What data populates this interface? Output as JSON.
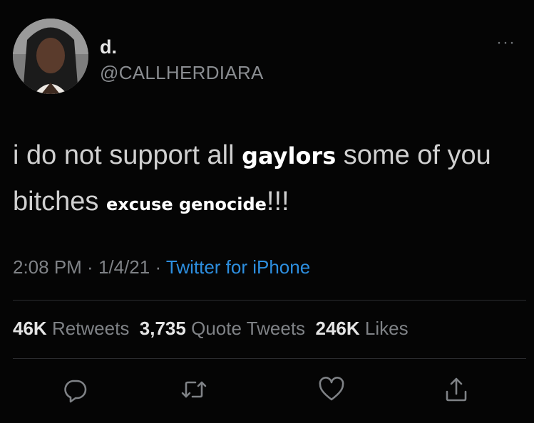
{
  "user": {
    "display_name": "d.",
    "handle": "@CALLHERDIARA",
    "avatar": "avatar-photo"
  },
  "tweet": {
    "text_part1": "i do not support all ",
    "overlay1": "gaylors",
    "text_part2": " some of you bitches ",
    "overlay2": "excuse genocide",
    "text_part3": "!!!"
  },
  "meta": {
    "time": "2:08 PM",
    "sep1": " · ",
    "date": "1/4/21",
    "sep2": " · ",
    "source": "Twitter for iPhone"
  },
  "stats": {
    "retweets_count": "46K",
    "retweets_label": "Retweets",
    "quotes_count": "3,735",
    "quotes_label": "Quote Tweets",
    "likes_count": "246K",
    "likes_label": "Likes"
  },
  "actions": [
    "reply-icon",
    "retweet-icon",
    "like-icon",
    "share-icon"
  ],
  "colors": {
    "background": "#050505",
    "link": "#2d8fe0",
    "muted": "#7f8286"
  }
}
